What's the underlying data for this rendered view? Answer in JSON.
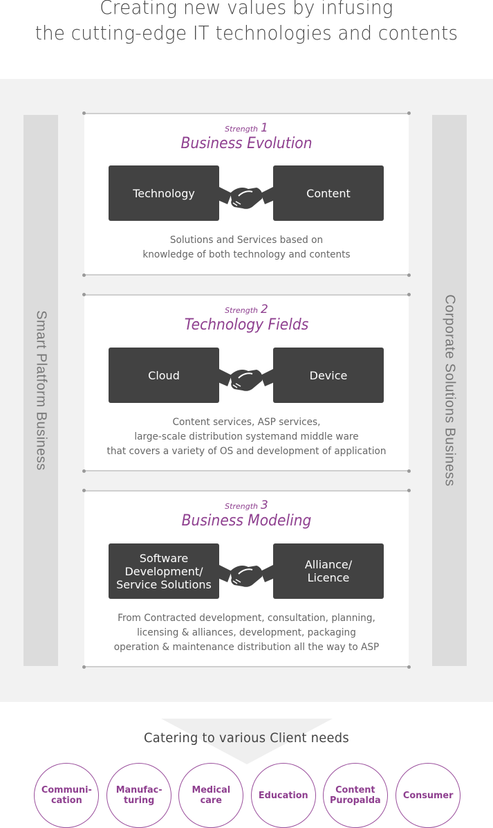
{
  "headline": {
    "line1": "Creating new values by infusing",
    "line2": "the cutting-edge IT technologies and contents"
  },
  "side_labels": {
    "left": "Smart Platform Business",
    "right": "Corporate Solutions Business"
  },
  "strengths": [
    {
      "label": "Strength",
      "number": "1",
      "title": "Business Evolution",
      "left_box": "Technology",
      "right_box": "Content",
      "connector_icon": "handshake-icon",
      "description": [
        "Solutions and Services based on",
        "knowledge of both technology and contents"
      ]
    },
    {
      "label": "Strength",
      "number": "2",
      "title": "Technology Fields",
      "left_box": "Cloud",
      "right_box": "Device",
      "connector_icon": "handshake-icon",
      "description": [
        "Content services, ASP services,",
        "large-scale distribution systemand middle ware",
        "that covers a variety of OS and development of application"
      ]
    },
    {
      "label": "Strength",
      "number": "3",
      "title": "Business Modeling",
      "left_box": "Software\nDevelopment/\nService Solutions",
      "right_box": "Alliance/\nLicence",
      "connector_icon": "handshake-icon",
      "description": [
        "From Contracted development, consultation, planning,",
        "licensing & alliances, development, packaging",
        "operation & maintenance distribution all the way to ASP"
      ]
    }
  ],
  "clients": {
    "title": "Catering to various Client needs",
    "items": [
      "Communi-\ncation",
      "Manufac-\nturing",
      "Medical\ncare",
      "Education",
      "Content\nPuropalda",
      "Consumer"
    ]
  },
  "colors": {
    "accent_purple": "#8e3f8f",
    "box_dark": "#424242",
    "band_gray": "#f2f2f2",
    "sidebar_gray": "#dcdcdc"
  }
}
